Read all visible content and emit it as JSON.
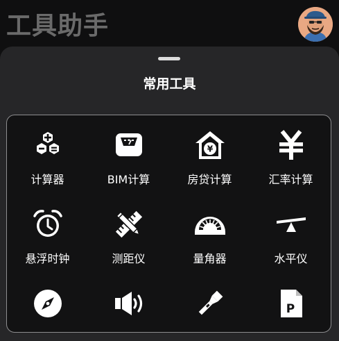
{
  "app": {
    "title": "工具助手"
  },
  "sheet": {
    "title": "常用工具"
  },
  "tools": [
    {
      "label": "计算器",
      "icon": "calculator-icon"
    },
    {
      "label": "BIM计算",
      "icon": "scale-icon"
    },
    {
      "label": "房贷计算",
      "icon": "house-loan-icon"
    },
    {
      "label": "汇率计算",
      "icon": "yen-exchange-icon"
    },
    {
      "label": "悬浮时钟",
      "icon": "alarm-clock-icon"
    },
    {
      "label": "测距仪",
      "icon": "ruler-pencil-icon"
    },
    {
      "label": "量角器",
      "icon": "protractor-icon"
    },
    {
      "label": "水平仪",
      "icon": "level-icon"
    },
    {
      "label": "",
      "icon": "compass-icon"
    },
    {
      "label": "",
      "icon": "speaker-icon"
    },
    {
      "label": "",
      "icon": "flashlight-icon"
    },
    {
      "label": "",
      "icon": "parking-icon"
    }
  ],
  "colors": {
    "background": "#0f0f10",
    "sheet": "#262628",
    "panel": "#121213",
    "text": "#ffffff",
    "title_muted": "#6a6a6a"
  }
}
